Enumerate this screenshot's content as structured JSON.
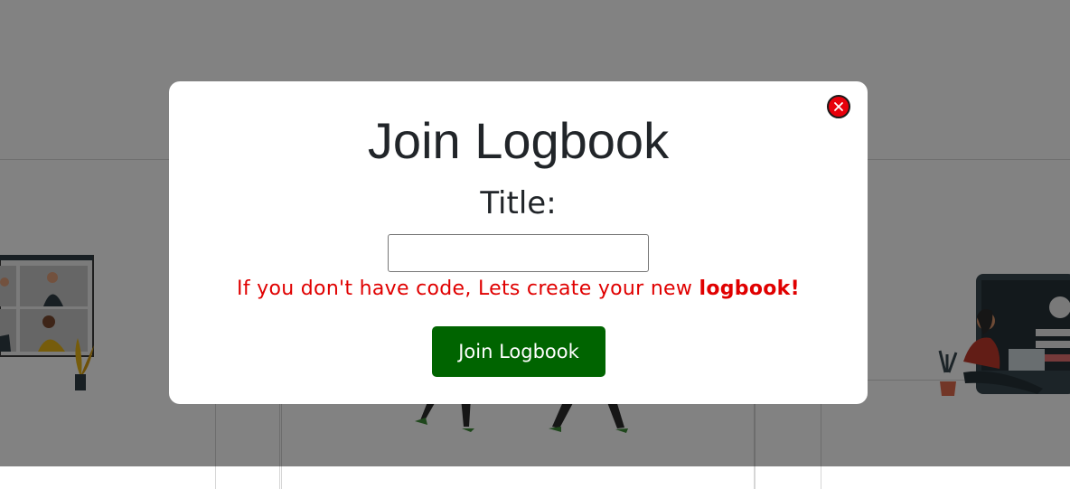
{
  "modal": {
    "title": "Join Logbook",
    "field_label": "Title:",
    "input_value": "",
    "input_placeholder": "",
    "hint_text": "If you don't have code, Lets create your new ",
    "hint_emphasis": "logbook!",
    "submit_label": "Join Logbook",
    "close_icon": "close-icon"
  },
  "colors": {
    "overlay": "#000000",
    "hint": "#e00000",
    "submit_bg": "#006400",
    "close_bg": "#e8000b"
  }
}
